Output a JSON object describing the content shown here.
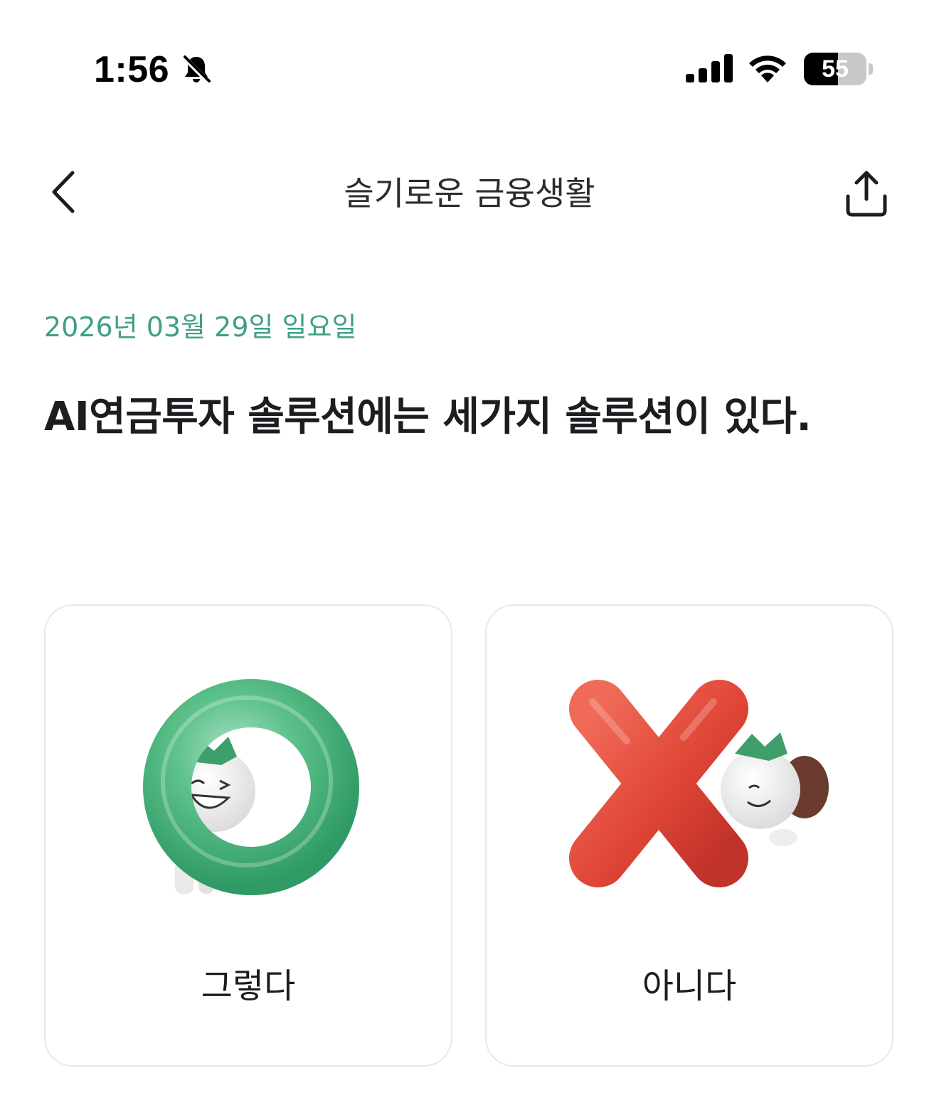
{
  "status_bar": {
    "time": "1:56",
    "battery_level": "55",
    "battery_fraction": 0.55
  },
  "header": {
    "title": "슬기로운 금융생활"
  },
  "quiz": {
    "date": "2026년 03월 29일 일요일",
    "question": "AI연금투자 솔루션에는 세가지 솔루션이 있다."
  },
  "answers": [
    {
      "label": "그렇다",
      "icon": "o-mark-character-icon",
      "color": "#4db57f"
    },
    {
      "label": "아니다",
      "icon": "x-mark-character-icon",
      "color": "#e04636"
    }
  ],
  "colors": {
    "accent": "#3e9f86",
    "yes": "#4db57f",
    "no": "#e04636",
    "card_border": "#e6e7ea"
  }
}
